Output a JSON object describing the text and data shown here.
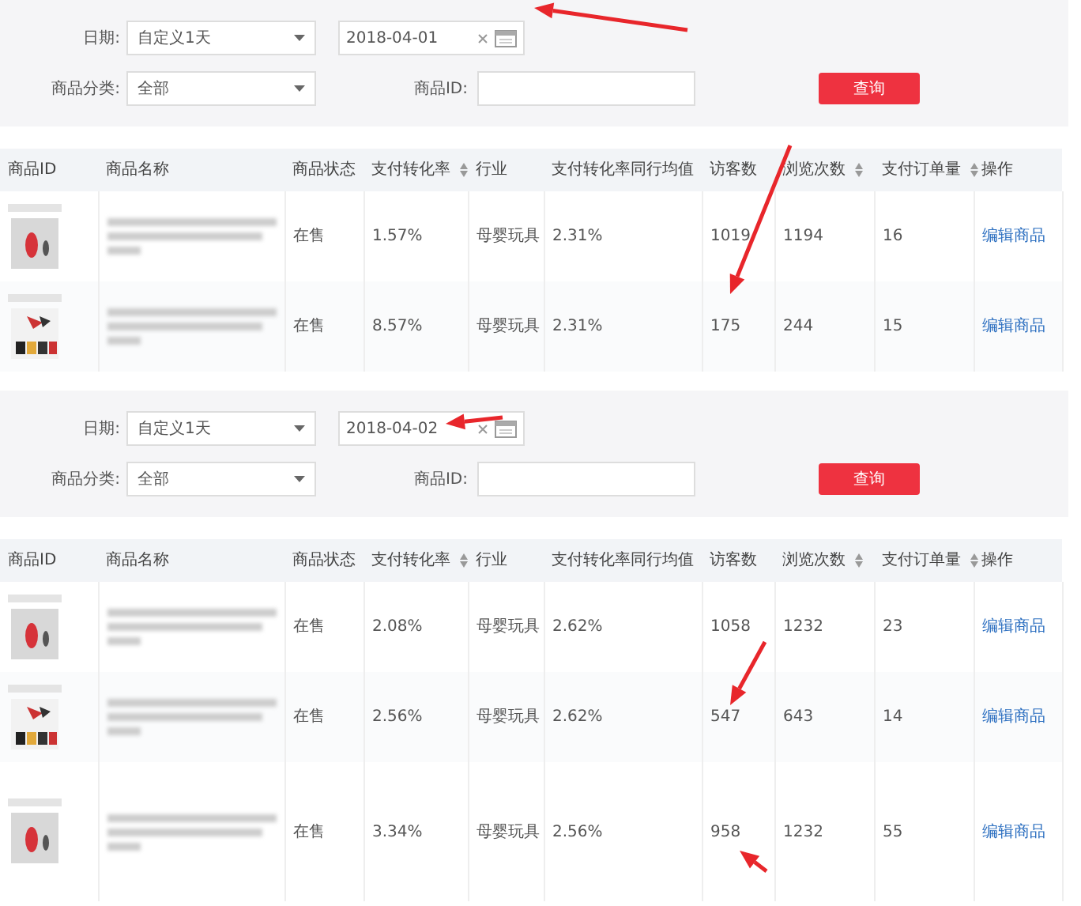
{
  "panels": [
    {
      "filters": {
        "date_label": "日期:",
        "date_range": "自定义1天",
        "date_value": "2018-04-01",
        "category_label": "商品分类:",
        "category": "全部",
        "id_label": "商品ID:",
        "query_button": "查询"
      },
      "table": {
        "columns": [
          {
            "label": "商品ID"
          },
          {
            "label": "商品名称"
          },
          {
            "label": "商品状态"
          },
          {
            "label": "支付转化率",
            "sortable": true
          },
          {
            "label": "行业"
          },
          {
            "label": "支付转化率同行均值"
          },
          {
            "label": "访客数"
          },
          {
            "label": "浏览次数",
            "sortable": true
          },
          {
            "label": "支付订单量",
            "sortable": true
          },
          {
            "label": "操作"
          }
        ],
        "rows": [
          {
            "kind": "picture",
            "status": "在售",
            "rate": "1.57%",
            "industry": "母婴玩具",
            "avg": "2.31%",
            "visitors": "1019",
            "views": "1194",
            "orders": "16",
            "action": "编辑商品"
          },
          {
            "kind": "picture",
            "status": "在售",
            "rate": "8.57%",
            "industry": "母婴玩具",
            "avg": "2.31%",
            "visitors": "175",
            "views": "244",
            "orders": "15",
            "action": "编辑商品"
          }
        ]
      }
    },
    {
      "filters": {
        "date_label": "日期:",
        "date_range": "自定义1天",
        "date_value": "2018-04-02",
        "category_label": "商品分类:",
        "category": "全部",
        "id_label": "商品ID:",
        "query_button": "查询"
      },
      "table": {
        "columns": [
          {
            "label": "商品ID"
          },
          {
            "label": "商品名称"
          },
          {
            "label": "商品状态"
          },
          {
            "label": "支付转化率",
            "sortable": true
          },
          {
            "label": "行业"
          },
          {
            "label": "支付转化率同行均值"
          },
          {
            "label": "访客数"
          },
          {
            "label": "浏览次数",
            "sortable": true
          },
          {
            "label": "支付订单量",
            "sortable": true
          },
          {
            "label": "操作"
          }
        ],
        "rows": [
          {
            "kind": "picture",
            "status": "在售",
            "rate": "2.08%",
            "industry": "母婴玩具",
            "avg": "2.62%",
            "visitors": "1058",
            "views": "1232",
            "orders": "23",
            "action": "编辑商品"
          },
          {
            "kind": "picture",
            "status": "在售",
            "rate": "2.56%",
            "industry": "母婴玩具",
            "avg": "2.62%",
            "visitors": "547",
            "views": "643",
            "orders": "14",
            "action": "编辑商品"
          },
          {
            "kind": "picture",
            "status": "在售",
            "rate": "3.34%",
            "industry": "母婴玩具",
            "avg": "2.56%",
            "visitors": "958",
            "views": "1232",
            "orders": "55",
            "action": "编辑商品"
          }
        ]
      }
    }
  ]
}
